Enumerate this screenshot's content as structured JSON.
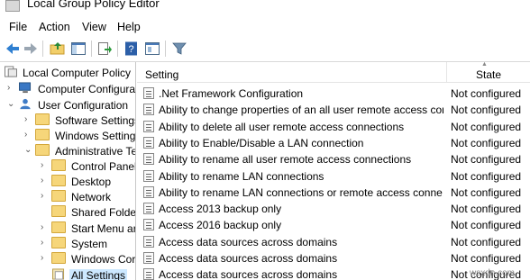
{
  "window": {
    "title": "Local Group Policy Editor"
  },
  "menu": [
    "File",
    "Action",
    "View",
    "Help"
  ],
  "toolbar": {
    "icons": [
      "back-icon",
      "forward-icon",
      "up-folder-icon",
      "show-hide-tree-icon",
      "export-icon",
      "help-icon",
      "properties-icon",
      "filter-icon"
    ]
  },
  "tree": {
    "items": [
      {
        "label": "Local Computer Policy"
      },
      {
        "label": "Computer Configura"
      },
      {
        "label": "User Configuration"
      },
      {
        "label": "Software Settings"
      },
      {
        "label": "Windows Setting"
      },
      {
        "label": "Administrative Te"
      },
      {
        "label": "Control Panel"
      },
      {
        "label": "Desktop"
      },
      {
        "label": "Network"
      },
      {
        "label": "Shared Folder"
      },
      {
        "label": "Start Menu ar"
      },
      {
        "label": "System"
      },
      {
        "label": "Windows Cor"
      },
      {
        "label": "All Settings"
      }
    ]
  },
  "list": {
    "columns": {
      "setting": "Setting",
      "state": "State"
    },
    "rows": [
      {
        "name": ".Net Framework Configuration",
        "state": "Not configured"
      },
      {
        "name": "Ability to change properties of an all user remote access con...",
        "state": "Not configured"
      },
      {
        "name": "Ability to delete all user remote access connections",
        "state": "Not configured"
      },
      {
        "name": "Ability to Enable/Disable a LAN connection",
        "state": "Not configured"
      },
      {
        "name": "Ability to rename all user remote access connections",
        "state": "Not configured"
      },
      {
        "name": "Ability to rename LAN connections",
        "state": "Not configured"
      },
      {
        "name": "Ability to rename LAN connections or remote access conne...",
        "state": "Not configured"
      },
      {
        "name": "Access 2013 backup only",
        "state": "Not configured"
      },
      {
        "name": "Access 2016 backup only",
        "state": "Not configured"
      },
      {
        "name": "Access data sources across domains",
        "state": "Not configured"
      },
      {
        "name": "Access data sources across domains",
        "state": "Not configured"
      },
      {
        "name": "Access data sources across domains",
        "state": "Not configured"
      }
    ]
  },
  "watermark": "wsxdn.com"
}
